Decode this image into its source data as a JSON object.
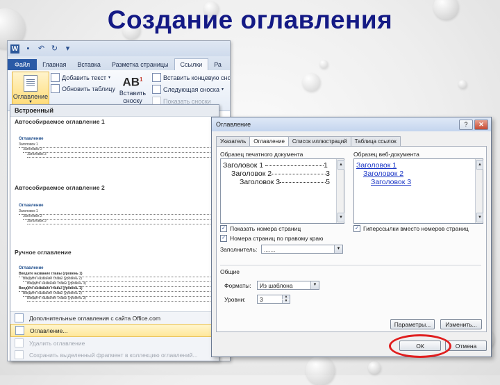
{
  "slide": {
    "title": "Создание оглавления"
  },
  "ribbon": {
    "tabs": [
      "Файл",
      "Главная",
      "Вставка",
      "Разметка страницы",
      "Ссылки",
      "Ра"
    ],
    "toc_button": "Оглавление",
    "toc_arrow": "▼",
    "add_text": "Добавить текст",
    "update_table": "Обновить таблицу",
    "insert_footnote_line1": "Вставить",
    "insert_footnote_line2": "сноску",
    "ab_label": "AB",
    "ab_sup": "1",
    "insert_endnote": "Вставить концевую сноск",
    "next_footnote": "Следующая сноска",
    "show_notes": "Показать сноски"
  },
  "gallery": {
    "header": "Встроенный",
    "auto1": "Автособираемое оглавление 1",
    "auto2": "Автособираемое оглавление 2",
    "manual": "Ручное оглавление",
    "heading": "Оглавление",
    "h1": "Заголовок 1",
    "h2": "Заголовок 2",
    "h3": "Заголовок 3",
    "ch1": "Введите название главы (уровень 1)",
    "ch2": "Введите название главы (уровень 2)",
    "ch3": "Введите название главы (уровень 3)",
    "p1": "1",
    "p4": "4",
    "menu": [
      "Дополнительные оглавления с сайта Office.com",
      "Оглавление...",
      "Удалить оглавление",
      "Сохранить выделенный фрагмент в коллекцию оглавлений..."
    ]
  },
  "dialog": {
    "title": "Оглавление",
    "help": "?",
    "close": "✕",
    "tabs": [
      "Указатель",
      "Оглавление",
      "Список иллюстраций",
      "Таблица ссылок"
    ],
    "print_preview_label": "Образец печатного документа",
    "web_preview_label": "Образец веб-документа",
    "print_preview": [
      {
        "text": "Заголовок 1",
        "page": "1"
      },
      {
        "text": "Заголовок 2",
        "page": "3"
      },
      {
        "text": "Заголовок 3",
        "page": "5"
      }
    ],
    "web_preview": [
      "Заголовок 1",
      "Заголовок 2",
      "Заголовок 3"
    ],
    "show_page_numbers": "Показать номера страниц",
    "right_align": "Номера страниц по правому краю",
    "hyperlinks": "Гиперссылки вместо номеров страниц",
    "tab_leader_label": "Заполнитель:",
    "tab_leader_value": ".......",
    "general_label": "Общие",
    "formats_label": "Форматы:",
    "formats_value": "Из шаблона",
    "levels_label": "Уровни:",
    "levels_value": "3",
    "options_button": "Параметры...",
    "modify_button": "Изменить...",
    "ok_button": "ОК",
    "cancel_button": "Отмена",
    "check": "✓"
  }
}
